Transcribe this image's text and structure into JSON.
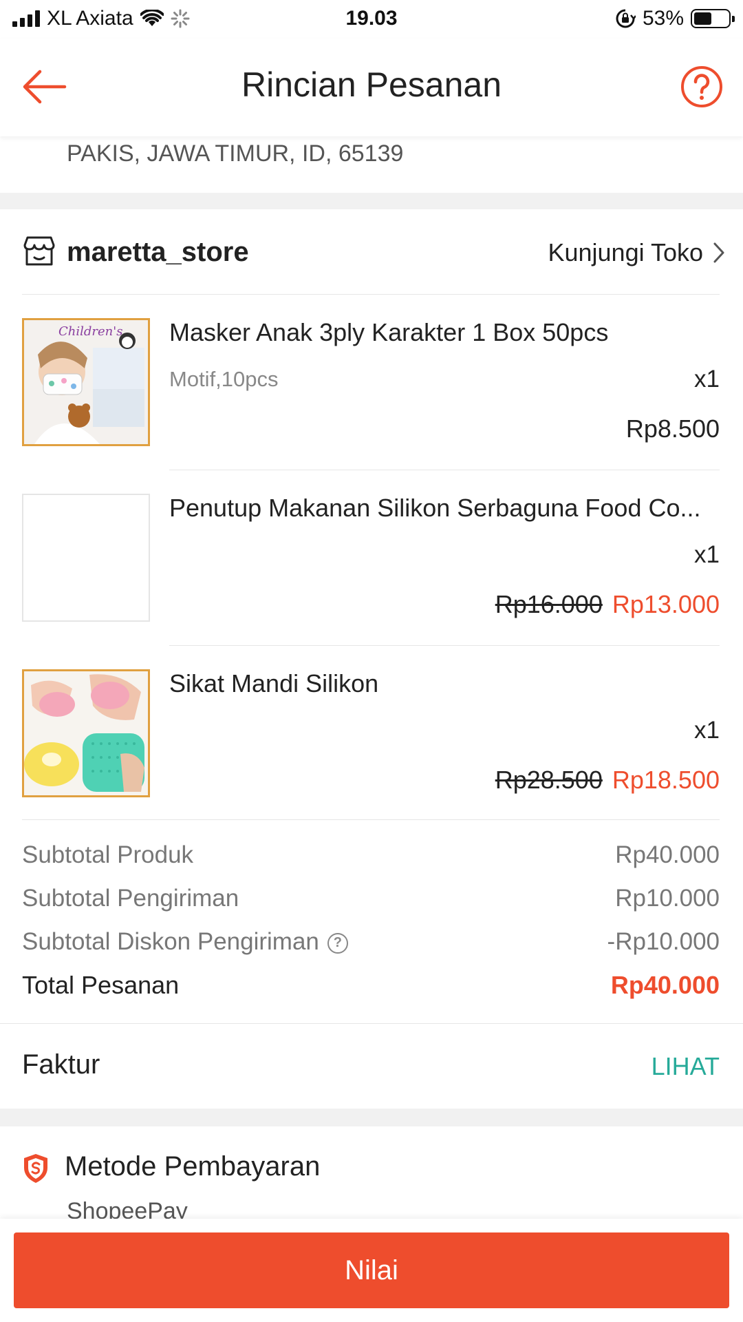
{
  "status_bar": {
    "carrier": "XL Axiata",
    "time": "19.03",
    "battery_percent": "53%",
    "battery_level": 0.53
  },
  "header": {
    "title": "Rincian Pesanan",
    "back_icon": "back-arrow-icon",
    "help_icon": "help-circle-icon"
  },
  "address": {
    "line": "PAKIS, JAWA TIMUR, ID, 65139"
  },
  "shop": {
    "name": "maretta_store",
    "visit_label": "Kunjungi Toko",
    "icon": "store-icon"
  },
  "products": [
    {
      "name": "Masker Anak 3ply Karakter 1 Box 50pcs",
      "variant": "Motif,10pcs",
      "qty": "x1",
      "price": "Rp8.500"
    },
    {
      "name": "Penutup Makanan Silikon Serbaguna Food Co...",
      "variant": "",
      "qty": "x1",
      "old_price": "Rp16.000",
      "price": "Rp13.000"
    },
    {
      "name": "Sikat Mandi Silikon",
      "variant": "",
      "qty": "x1",
      "old_price": "Rp28.500",
      "price": "Rp18.500"
    }
  ],
  "summary": {
    "subtotal_product_label": "Subtotal Produk",
    "subtotal_product_value": "Rp40.000",
    "subtotal_shipping_label": "Subtotal Pengiriman",
    "subtotal_shipping_value": "Rp10.000",
    "shipping_discount_label": "Subtotal Diskon Pengiriman",
    "shipping_discount_value": "-Rp10.000",
    "total_label": "Total Pesanan",
    "total_value": "Rp40.000"
  },
  "invoice": {
    "label": "Faktur",
    "link": "LIHAT"
  },
  "payment": {
    "title": "Metode Pembayaran",
    "value": "ShopeePay"
  },
  "bottom": {
    "button_label": "Nilai"
  },
  "colors": {
    "accent": "#ee4d2d",
    "link": "#26aa99",
    "muted": "#777777"
  }
}
